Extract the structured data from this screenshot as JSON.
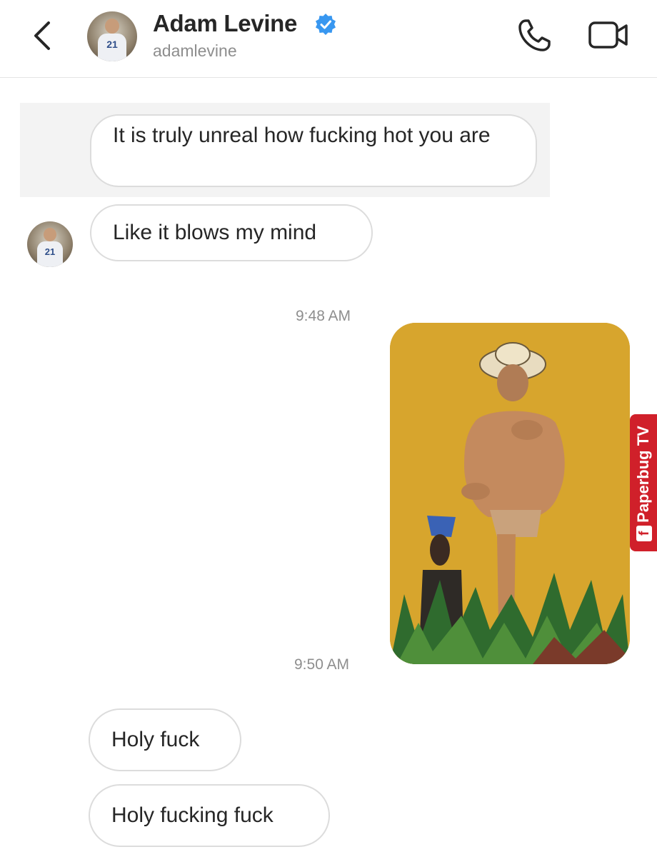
{
  "header": {
    "display_name": "Adam Levine",
    "username": "adamlevine",
    "avatar_jersey_number": "21"
  },
  "messages": [
    {
      "text": "It is truly unreal how fucking hot you are"
    },
    {
      "text": "Like it blows my mind"
    }
  ],
  "timestamps": [
    "9:48 AM",
    "9:50 AM"
  ],
  "attachment": {
    "watermark": "Paperbug TV"
  },
  "replies": [
    {
      "text": "Holy fuck"
    },
    {
      "text": "Holy fucking fuck"
    }
  ],
  "colors": {
    "verified_badge": "#3897f0",
    "photo_background": "#d7a52d",
    "watermark": "#d0202a"
  },
  "icons": [
    "back-chevron-icon",
    "verified-badge-icon",
    "phone-icon",
    "video-camera-icon",
    "facebook-icon"
  ]
}
